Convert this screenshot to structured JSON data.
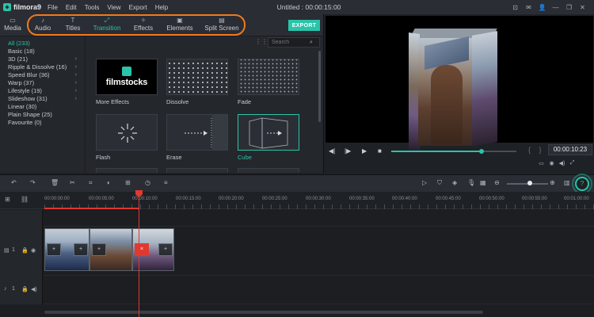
{
  "app": {
    "logo_text": "filmora9",
    "window_title": "Untitled : 00:00:15:00",
    "menu": [
      "File",
      "Edit",
      "Tools",
      "View",
      "Export",
      "Help"
    ],
    "window_controls": [
      "⊡",
      "✉",
      "👤",
      "—",
      "❐",
      "✕"
    ]
  },
  "tabs": [
    {
      "label": "Media",
      "icon": "folder-icon",
      "glyph": "▭"
    },
    {
      "label": "Audio",
      "icon": "music-note-icon",
      "glyph": "♪"
    },
    {
      "label": "Titles",
      "icon": "text-icon",
      "glyph": "T"
    },
    {
      "label": "Transition",
      "icon": "transition-icon",
      "glyph": "⤢"
    },
    {
      "label": "Effects",
      "icon": "effects-icon",
      "glyph": "✧"
    },
    {
      "label": "Elements",
      "icon": "image-icon",
      "glyph": "▣"
    },
    {
      "label": "Split Screen",
      "icon": "split-screen-icon",
      "glyph": "▤"
    }
  ],
  "export_label": "EXPORT",
  "accent_color": "#29c4a9",
  "highlight_color": "#f07a1c",
  "categories": [
    {
      "label": "All (233)",
      "active": true,
      "chevron": false
    },
    {
      "label": "Basic (18)",
      "active": false,
      "chevron": false
    },
    {
      "label": "3D (21)",
      "active": false,
      "chevron": true
    },
    {
      "label": "Ripple & Dissolve (16)",
      "active": false,
      "chevron": true
    },
    {
      "label": "Speed Blur (36)",
      "active": false,
      "chevron": true
    },
    {
      "label": "Warp (37)",
      "active": false,
      "chevron": true
    },
    {
      "label": "Lifestyle (19)",
      "active": false,
      "chevron": true
    },
    {
      "label": "Slideshow (31)",
      "active": false,
      "chevron": true
    },
    {
      "label": "Linear (30)",
      "active": false,
      "chevron": false
    },
    {
      "label": "Plain Shape (25)",
      "active": false,
      "chevron": false
    },
    {
      "label": "Favourite (0)",
      "active": false,
      "chevron": false
    }
  ],
  "search_placeholder": "Search",
  "transitions": [
    {
      "label": "More Effects",
      "brand": "filmstocks"
    },
    {
      "label": "Dissolve"
    },
    {
      "label": "Fade"
    },
    {
      "label": "Flash"
    },
    {
      "label": "Erase"
    },
    {
      "label": "Cube",
      "selected": true
    }
  ],
  "player": {
    "timecode": "00:00:10:23",
    "progress": 0.72
  },
  "ruler_labels": [
    "00:00:00:00",
    "00:00:05:00",
    "00:00:10:00",
    "00:00:15:00",
    "00:00:20:00",
    "00:00:25:00",
    "00:00:30:00",
    "00:00:35:00",
    "00:00:40:00",
    "00:00:45:00",
    "00:00:50:00",
    "00:00:55:00",
    "00:01:00:00"
  ],
  "tracks": {
    "video_label": "1",
    "audio_label": "1"
  }
}
